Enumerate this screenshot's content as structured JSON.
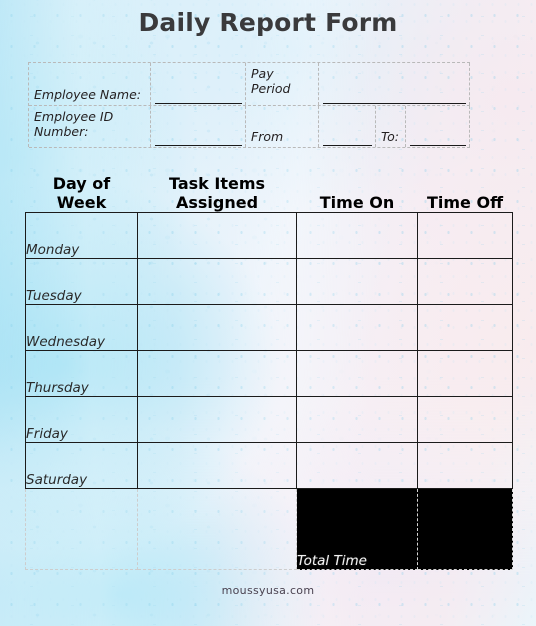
{
  "page": {
    "title": "Daily Report Form",
    "footer": "moussyusa.com",
    "background_colors": {
      "left_wash": "#bfe8f7",
      "right_wash": "#f7eef1",
      "mid_wash": "#eef4fb"
    },
    "accent_colors": {
      "header_band": "#000000",
      "header_text": "#f2f2f2",
      "title_text": "#3a3a3c",
      "body_border": "#1b1b1b",
      "dashed_border": "#b9b9b9"
    }
  },
  "info_form": {
    "row1": {
      "label": "Employee Name:",
      "value": "",
      "placeholder": "",
      "pay_period_label": "Pay\nPeriod",
      "pay_period_value": "",
      "pay_period_placeholder": ""
    },
    "row2": {
      "label": "Employee ID\nNumber:",
      "value": "",
      "placeholder": "",
      "from_label": "From",
      "from_value": "",
      "from_placeholder": "",
      "to_label": "To:",
      "to_value": "",
      "to_placeholder": ""
    }
  },
  "schedule_table": {
    "columns": [
      "Day of Week",
      "Task Items\nAssigned",
      "Time On",
      "Time Off"
    ],
    "rows": [
      {
        "day": "Monday",
        "task": "",
        "time_on": "",
        "time_off": ""
      },
      {
        "day": "Tuesday",
        "task": "",
        "time_on": "",
        "time_off": ""
      },
      {
        "day": "Wednesday",
        "task": "",
        "time_on": "",
        "time_off": ""
      },
      {
        "day": "Thursday",
        "task": "",
        "time_on": "",
        "time_off": ""
      },
      {
        "day": "Friday",
        "task": "",
        "time_on": "",
        "time_off": ""
      },
      {
        "day": "Saturday",
        "task": "",
        "time_on": "",
        "time_off": ""
      }
    ],
    "total_row": {
      "col1": "",
      "col2": "",
      "total_label": "Total Time",
      "total_value": ""
    }
  }
}
